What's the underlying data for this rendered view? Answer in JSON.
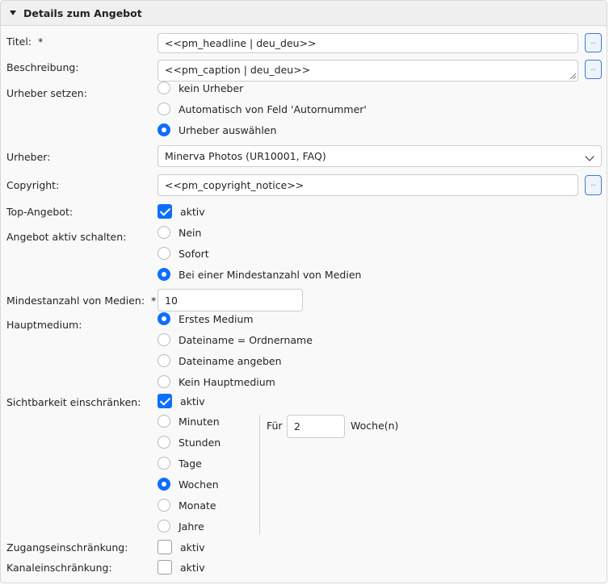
{
  "panel": {
    "title": "Details zum Angebot"
  },
  "fields": {
    "titel": {
      "label": "Titel:",
      "required": "*",
      "value": "<<pm_headline | deu_deu>>",
      "btn": ".."
    },
    "beschreibung": {
      "label": "Beschreibung:",
      "value": "<<pm_caption | deu_deu>>",
      "btn": ".."
    },
    "urheber_setzen": {
      "label": "Urheber setzen:",
      "options": [
        "kein Urheber",
        "Automatisch von Feld 'Autornummer'",
        "Urheber auswählen"
      ],
      "selected": "Urheber auswählen"
    },
    "urheber": {
      "label": "Urheber:",
      "value": "Minerva Photos (UR10001, FAQ)"
    },
    "copyright": {
      "label": "Copyright:",
      "value": "<<pm_copyright_notice>>",
      "btn": ".."
    },
    "top_angebot": {
      "label": "Top-Angebot:",
      "check_label": "aktiv",
      "checked": true
    },
    "angebot_aktiv": {
      "label": "Angebot aktiv schalten:",
      "options": [
        "Nein",
        "Sofort",
        "Bei einer Mindestanzahl von Medien"
      ],
      "selected": "Bei einer Mindestanzahl von Medien"
    },
    "mindestanzahl": {
      "label": "Mindestanzahl von Medien:",
      "required": "*",
      "value": "10"
    },
    "hauptmedium": {
      "label": "Hauptmedium:",
      "options": [
        "Erstes Medium",
        "Dateiname = Ordnername",
        "Dateiname angeben",
        "Kein Hauptmedium"
      ],
      "selected": "Erstes Medium"
    },
    "sichtbarkeit": {
      "label": "Sichtbarkeit einschränken:",
      "check_label": "aktiv",
      "checked": true,
      "units": [
        "Minuten",
        "Stunden",
        "Tage",
        "Wochen",
        "Monate",
        "Jahre"
      ],
      "selected_unit": "Wochen",
      "fuer_label": "Für",
      "fuer_value": "2",
      "fuer_unit": "Woche(n)"
    },
    "zugang": {
      "label": "Zugangseinschränkung:",
      "check_label": "aktiv",
      "checked": false
    },
    "kanal": {
      "label": "Kanaleinschränkung:",
      "check_label": "aktiv",
      "checked": false
    }
  },
  "colors": {
    "accent": "#0d6efd",
    "button_border": "#3a7bd5",
    "panel_bg": "#f9f9f9",
    "header_bg": "#f0f0f0"
  },
  "icons": {
    "collapse": "caret-down-icon",
    "select": "chevron-down-icon"
  }
}
